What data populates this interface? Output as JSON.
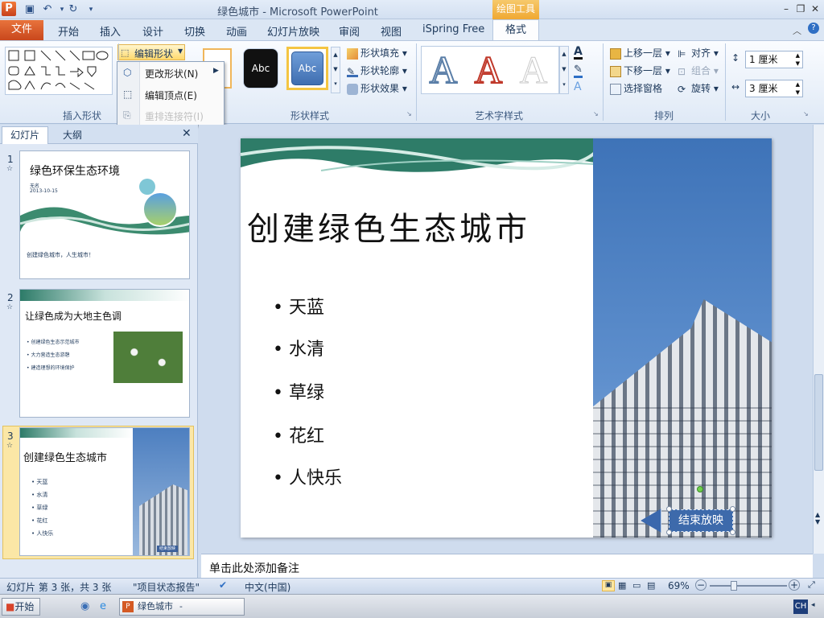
{
  "window": {
    "title": "绿色城市 - Microsoft PowerPoint",
    "app_logo": "P",
    "context_tab": "绘图工具"
  },
  "quick_access": {
    "save": "save-icon",
    "undo": "undo-icon",
    "redo": "redo-icon"
  },
  "tabs": [
    "文件",
    "开始",
    "插入",
    "设计",
    "切换",
    "动画",
    "幻灯片放映",
    "审阅",
    "视图",
    "iSpring Free",
    "格式"
  ],
  "ribbon": {
    "edit_shape": "编辑形状",
    "insert_shape_label": "插入形状",
    "shape_styles_label": "形状样式",
    "style_samples": [
      "Abc",
      "Abc"
    ],
    "shape_fill": "形状填充",
    "shape_outline": "形状轮廓",
    "shape_effects": "形状效果",
    "wordart_label": "艺术字样式",
    "wordart_letters": [
      "A",
      "A",
      "A"
    ],
    "bring_forward": "上移一层",
    "send_backward": "下移一层",
    "selection_pane": "选择窗格",
    "align": "对齐",
    "group": "组合",
    "rotate": "旋转",
    "arrange_label": "排列",
    "height": "1 厘米",
    "width": "3 厘米",
    "size_label": "大小"
  },
  "dropdown": {
    "change_shape": "更改形状(N)",
    "edit_points": "编辑顶点(E)",
    "reroute_connectors": "重排连接符(I)"
  },
  "left_pane": {
    "tab_slides": "幻灯片",
    "tab_outline": "大纲",
    "slides": [
      {
        "num": "1",
        "title": "绿色环保生态环境",
        "author": "无名",
        "date": "2013-10-15",
        "footer": "创建绿色城市，人生城市！"
      },
      {
        "num": "2",
        "title": "让绿色成为大地主色调",
        "bullets": [
          "创建绿色生态示范城市",
          "大力营造生态游憩",
          "建造理想的环境保护"
        ]
      },
      {
        "num": "3",
        "title": "创建绿色生态城市",
        "bullets": [
          "天蓝",
          "水清",
          "草绿",
          "花红",
          "人快乐"
        ],
        "button": "结束放映"
      }
    ]
  },
  "slide": {
    "title": "创建绿色生态城市",
    "bullets": [
      "天蓝",
      "水清",
      "草绿",
      "花红",
      "人快乐"
    ],
    "end_button": "结束放映"
  },
  "notes_placeholder": "单击此处添加备注",
  "status": {
    "slide_info": "幻灯片 第 3 张，共 3 张",
    "theme": "\"项目状态报告\"",
    "language": "中文(中国)",
    "zoom": "69%"
  },
  "taskbar": {
    "start": "开始",
    "task": "绿色城市 - Microsof...",
    "ime": "CH"
  },
  "colors": {
    "accent": "#e8733c",
    "context": "#f0a832",
    "ribbon": "#dfe9f6",
    "slide_blue": "#4d7fc0"
  }
}
